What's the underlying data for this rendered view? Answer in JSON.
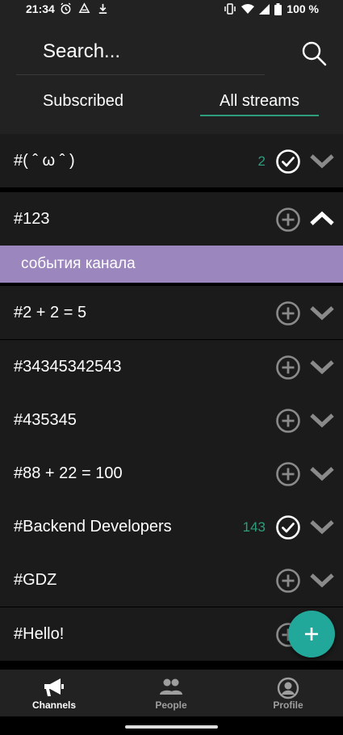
{
  "status_bar": {
    "time": "21:34",
    "battery": "100 %",
    "icons": [
      "alarm-icon",
      "drive-icon",
      "download-icon",
      "vibrate-icon",
      "wifi-icon",
      "signal-icon",
      "battery-icon"
    ]
  },
  "search": {
    "text": "Search..."
  },
  "tabs": [
    {
      "label": "Subscribed",
      "selected": false
    },
    {
      "label": "All streams",
      "selected": true
    }
  ],
  "streams": [
    {
      "name": "#( ˆ ω ˆ )",
      "count": "2",
      "subscribed": true,
      "expanded": false
    },
    {
      "name": "#123",
      "count": "",
      "subscribed": false,
      "expanded": true
    },
    {
      "name": "#2 + 2 = 5",
      "count": "",
      "subscribed": false,
      "expanded": false
    },
    {
      "name": "#34345342543",
      "count": "",
      "subscribed": false,
      "expanded": false
    },
    {
      "name": "#435345",
      "count": "",
      "subscribed": false,
      "expanded": false
    },
    {
      "name": "#88 + 22 = 100",
      "count": "",
      "subscribed": false,
      "expanded": false
    },
    {
      "name": "#Backend Developers",
      "count": "143",
      "subscribed": true,
      "expanded": false
    },
    {
      "name": "#GDZ",
      "count": "",
      "subscribed": false,
      "expanded": false
    },
    {
      "name": "#Hello!",
      "count": "",
      "subscribed": false,
      "expanded": false
    }
  ],
  "expanded_topic": {
    "label": "события канала"
  },
  "fab": {
    "icon": "plus-icon"
  },
  "bottom_nav": [
    {
      "label": "Channels",
      "icon": "megaphone-icon",
      "active": true
    },
    {
      "label": "People",
      "icon": "people-icon",
      "active": false
    },
    {
      "label": "Profile",
      "icon": "profile-icon",
      "active": false
    }
  ],
  "colors": {
    "accent": "#2e9d7b",
    "fab": "#22a89a",
    "topic_bg": "#9b86bd",
    "row_bg": "#1b1b1b",
    "header_bg": "#222222"
  }
}
